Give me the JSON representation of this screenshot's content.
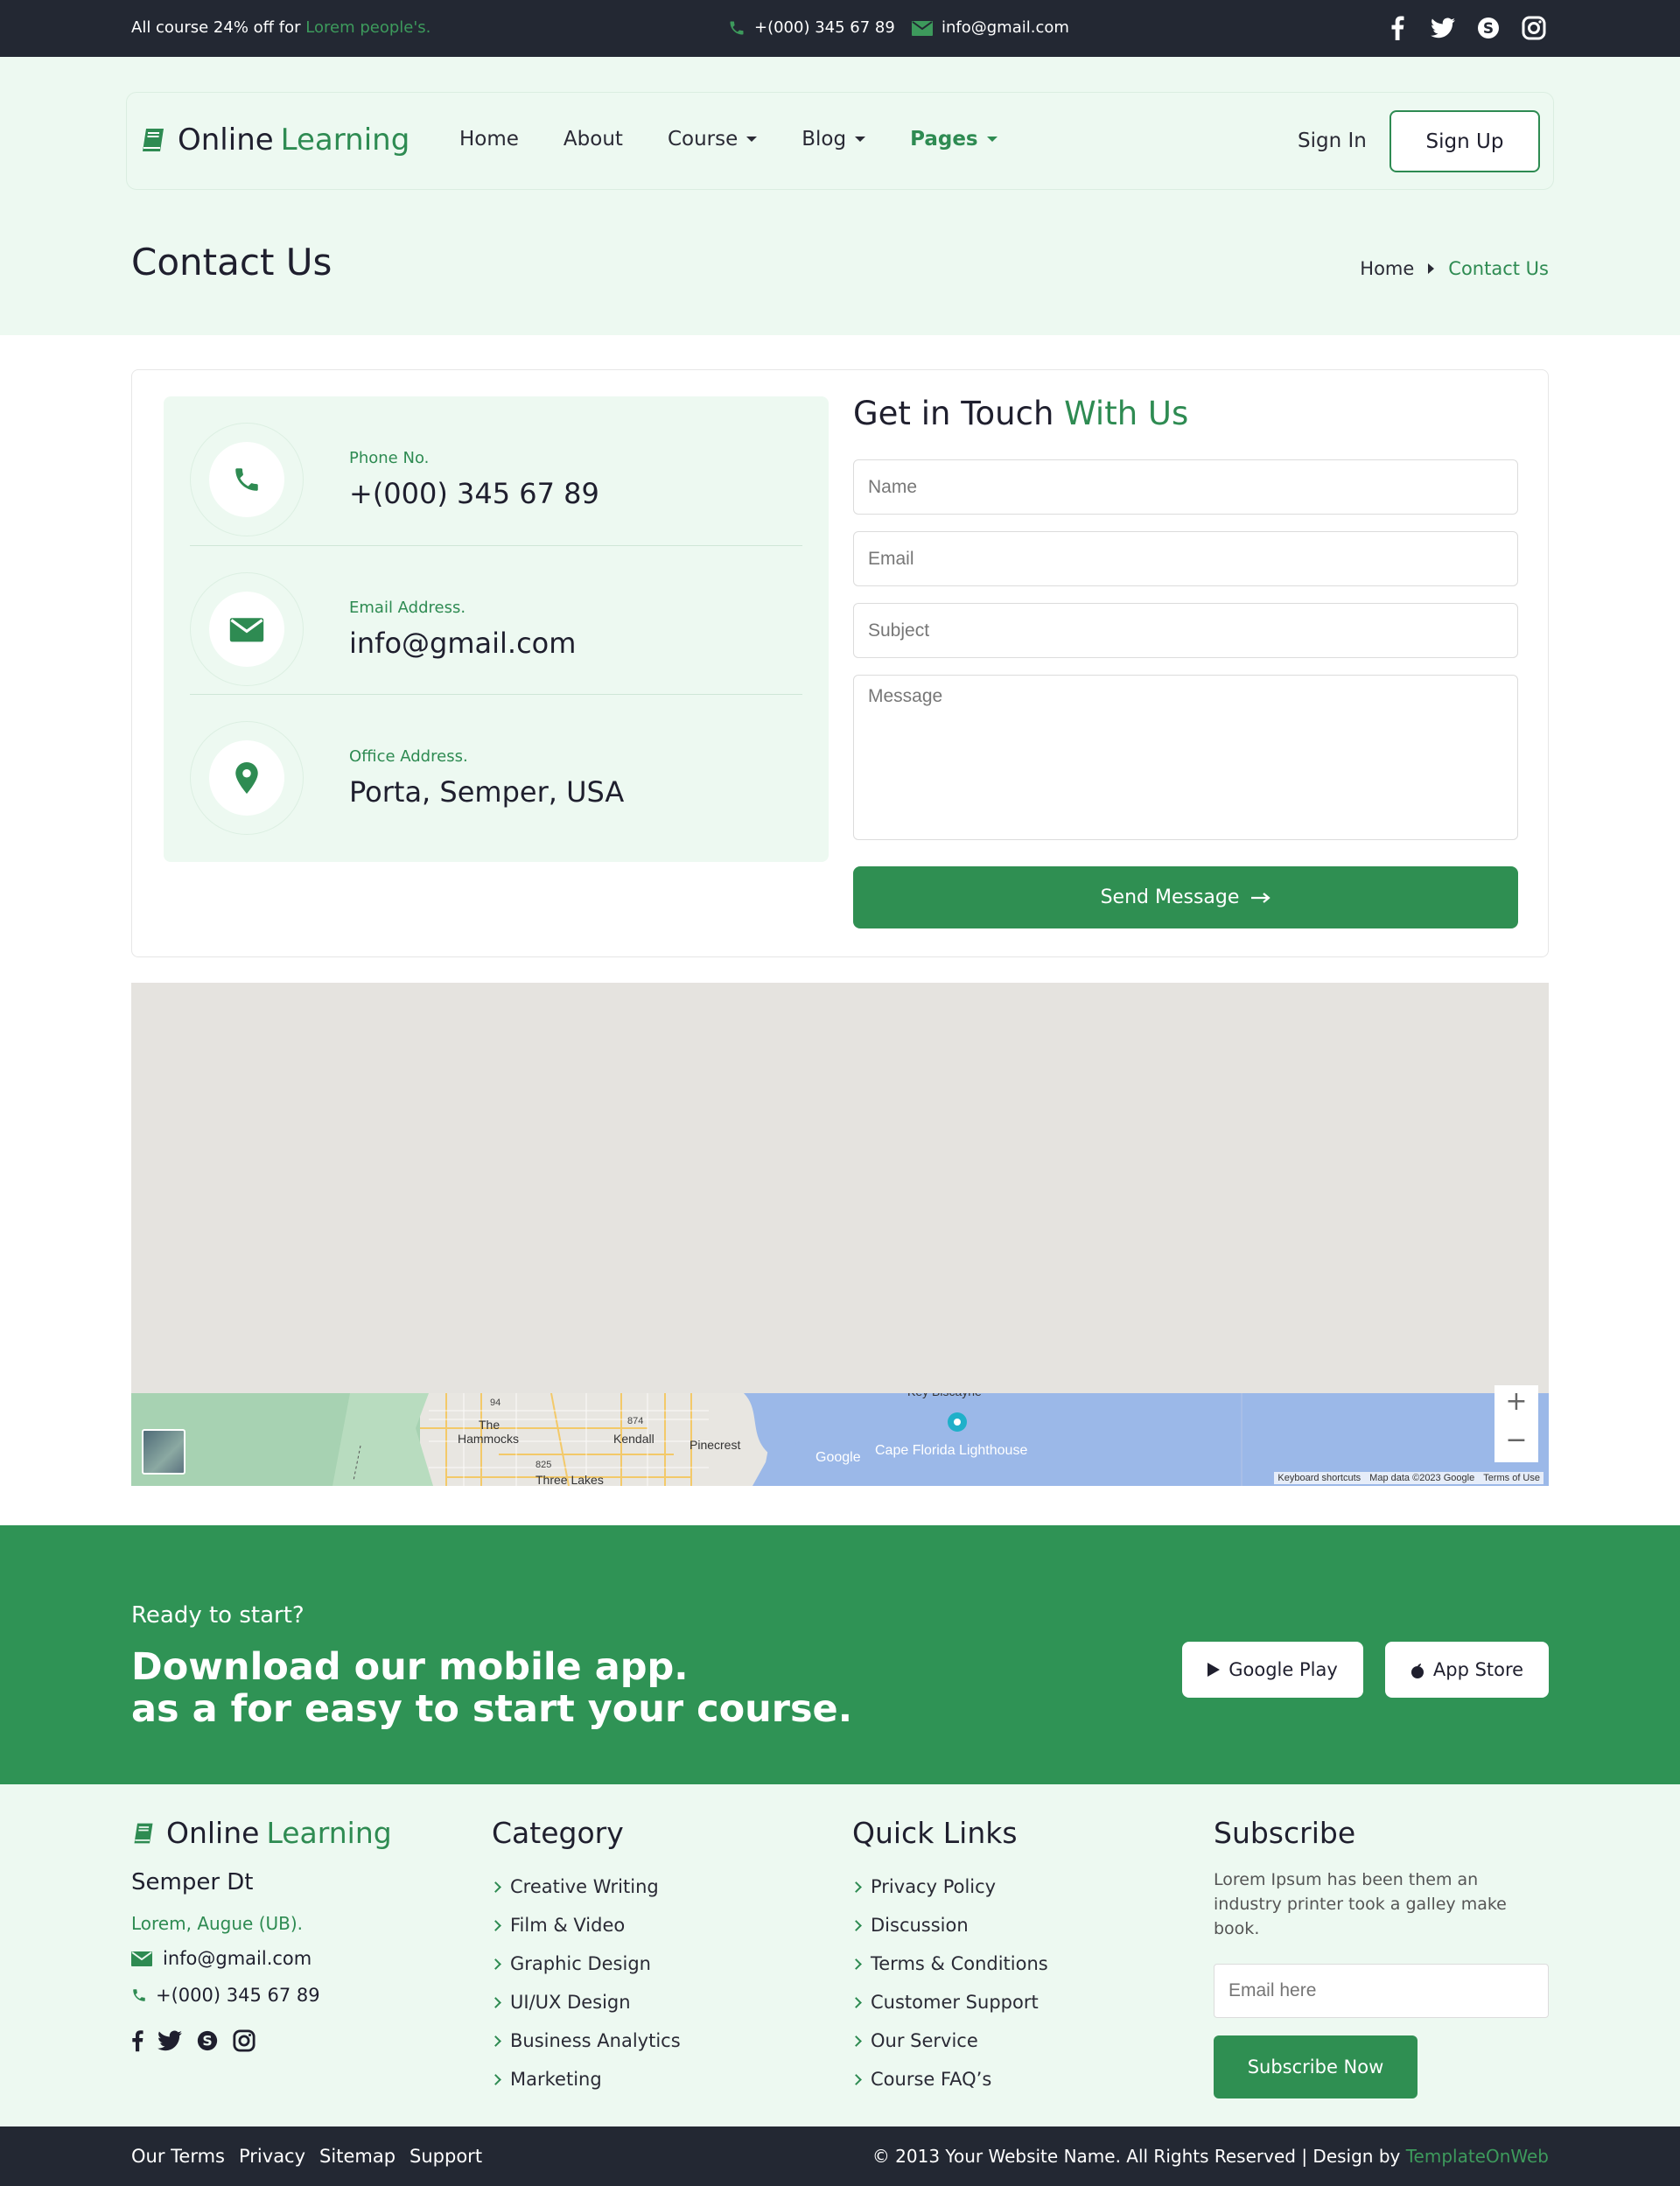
{
  "topbar": {
    "promo_prefix": "All course 24% off for",
    "promo_highlight": "Lorem people's.",
    "phone": "+(000) 345 67 89",
    "email": "info@gmail.com",
    "social_icons": [
      "facebook-icon",
      "twitter-icon",
      "skype-icon",
      "instagram-icon"
    ]
  },
  "brand": {
    "word1": "Online",
    "word2": "Learning",
    "accent_color": "#2e8b52"
  },
  "nav": {
    "items": [
      {
        "label": "Home"
      },
      {
        "label": "About"
      },
      {
        "label": "Course",
        "dropdown": true
      },
      {
        "label": "Blog",
        "dropdown": true
      },
      {
        "label": "Pages",
        "dropdown": true,
        "active": true
      }
    ],
    "sign_in": "Sign In",
    "sign_up": "Sign Up"
  },
  "page_header": {
    "title": "Contact Us",
    "breadcrumb": [
      "Home",
      "Contact Us"
    ]
  },
  "contact_info": [
    {
      "label": "Phone No.",
      "value": "+(000) 345 67 89",
      "icon": "phone-icon"
    },
    {
      "label": "Email Address.",
      "value": "info@gmail.com",
      "icon": "envelope-icon"
    },
    {
      "label": "Office Address.",
      "value": "Porta, Semper, USA",
      "icon": "map-pin-icon"
    }
  ],
  "form": {
    "title_main": "Get in Touch",
    "title_accent": "With Us",
    "name_placeholder": "Name",
    "email_placeholder": "Email",
    "subject_placeholder": "Subject",
    "message_placeholder": "Message",
    "submit_label": "Send Message"
  },
  "map": {
    "labels": [
      "The Hammocks",
      "Kendall",
      "Pinecrest",
      "Three Lakes",
      "Key Biscayne",
      "Cape Florida Lighthouse"
    ],
    "road_numbers": [
      "94",
      "874",
      "825"
    ],
    "google_text": "Google",
    "attribution": [
      "Keyboard shortcuts",
      "Map data ©2023 Google",
      "Terms of Use"
    ],
    "zoom_in": "+",
    "zoom_out": "−"
  },
  "app_promo": {
    "kicker": "Ready to start?",
    "headline_line1": "Download our mobile app.",
    "headline_line2": "as a for easy to start your course.",
    "google_play": "Google Play",
    "app_store": "App Store"
  },
  "footer": {
    "about": {
      "name": "Semper Dt",
      "address": "Lorem, Augue (UB).",
      "email": "info@gmail.com",
      "phone": "+(000) 345 67 89"
    },
    "category": {
      "title": "Category",
      "items": [
        "Creative Writing",
        "Film & Video",
        "Graphic Design",
        "UI/UX Design",
        "Business Analytics",
        "Marketing"
      ]
    },
    "quick_links": {
      "title": "Quick Links",
      "items": [
        "Privacy Policy",
        "Discussion",
        "Terms & Conditions",
        "Customer Support",
        "Our Service",
        "Course FAQ’s"
      ]
    },
    "subscribe": {
      "title": "Subscribe",
      "text": "Lorem Ipsum has been them an industry printer took a galley make book.",
      "placeholder": "Email here",
      "button": "Subscribe Now"
    }
  },
  "bottom_bar": {
    "links": [
      "Our Terms",
      "Privacy",
      "Sitemap",
      "Support"
    ],
    "copyright": "© 2013 Your Website Name. All Rights Reserved | Design by",
    "designer": "TemplateOnWeb"
  }
}
